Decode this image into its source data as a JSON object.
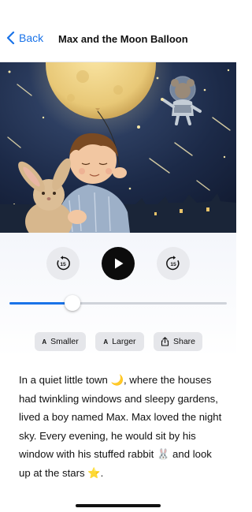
{
  "nav": {
    "back_label": "Back",
    "title": "Max and the Moon Balloon"
  },
  "hero": {
    "description": "Illustration of a boy in pajamas with a stuffed rabbit holding a balloon under a full moon, with a mouse astronaut floating in a starry sky"
  },
  "player": {
    "rewind_label": "15",
    "forward_label": "15",
    "progress": 0.29
  },
  "text_controls": {
    "smaller_prefix": "A",
    "smaller_label": "Smaller",
    "larger_prefix": "A",
    "larger_label": "Larger",
    "share_label": "Share"
  },
  "story": {
    "text": "In a quiet little town 🌙, where the houses had twinkling windows and sleepy gardens, lived a boy named Max. Max loved the night sky. Every evening, he would sit by his window with his stuffed rabbit 🐰 and look up at the stars ⭐."
  },
  "colors": {
    "accent": "#1a73e8",
    "play_button": "#0c0c0c",
    "chip_bg": "#e5e6ea"
  }
}
